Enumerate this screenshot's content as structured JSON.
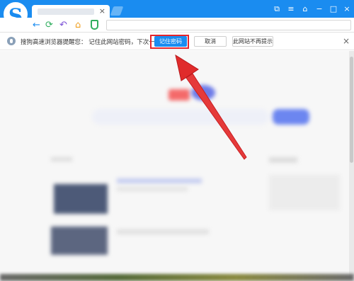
{
  "window": {
    "tab_close_glyph": "×",
    "controls": [
      "⧉",
      "≡",
      "⌂",
      "−",
      "□",
      "×"
    ]
  },
  "toolbar": {
    "back_glyph": "←",
    "refresh_glyph": "⟳",
    "undo_glyph": "↶",
    "home_glyph": "⌂"
  },
  "password_bar": {
    "message": "搜狗高速浏览器提醒您：  记住此网站密码，下次一键登录！",
    "remember_label": "记住密码",
    "cancel_label": "取消",
    "never_label": "此网站不再提示",
    "close_glyph": "×"
  },
  "colors": {
    "brand": "#1a8cf0",
    "highlight": "#e4242b"
  }
}
